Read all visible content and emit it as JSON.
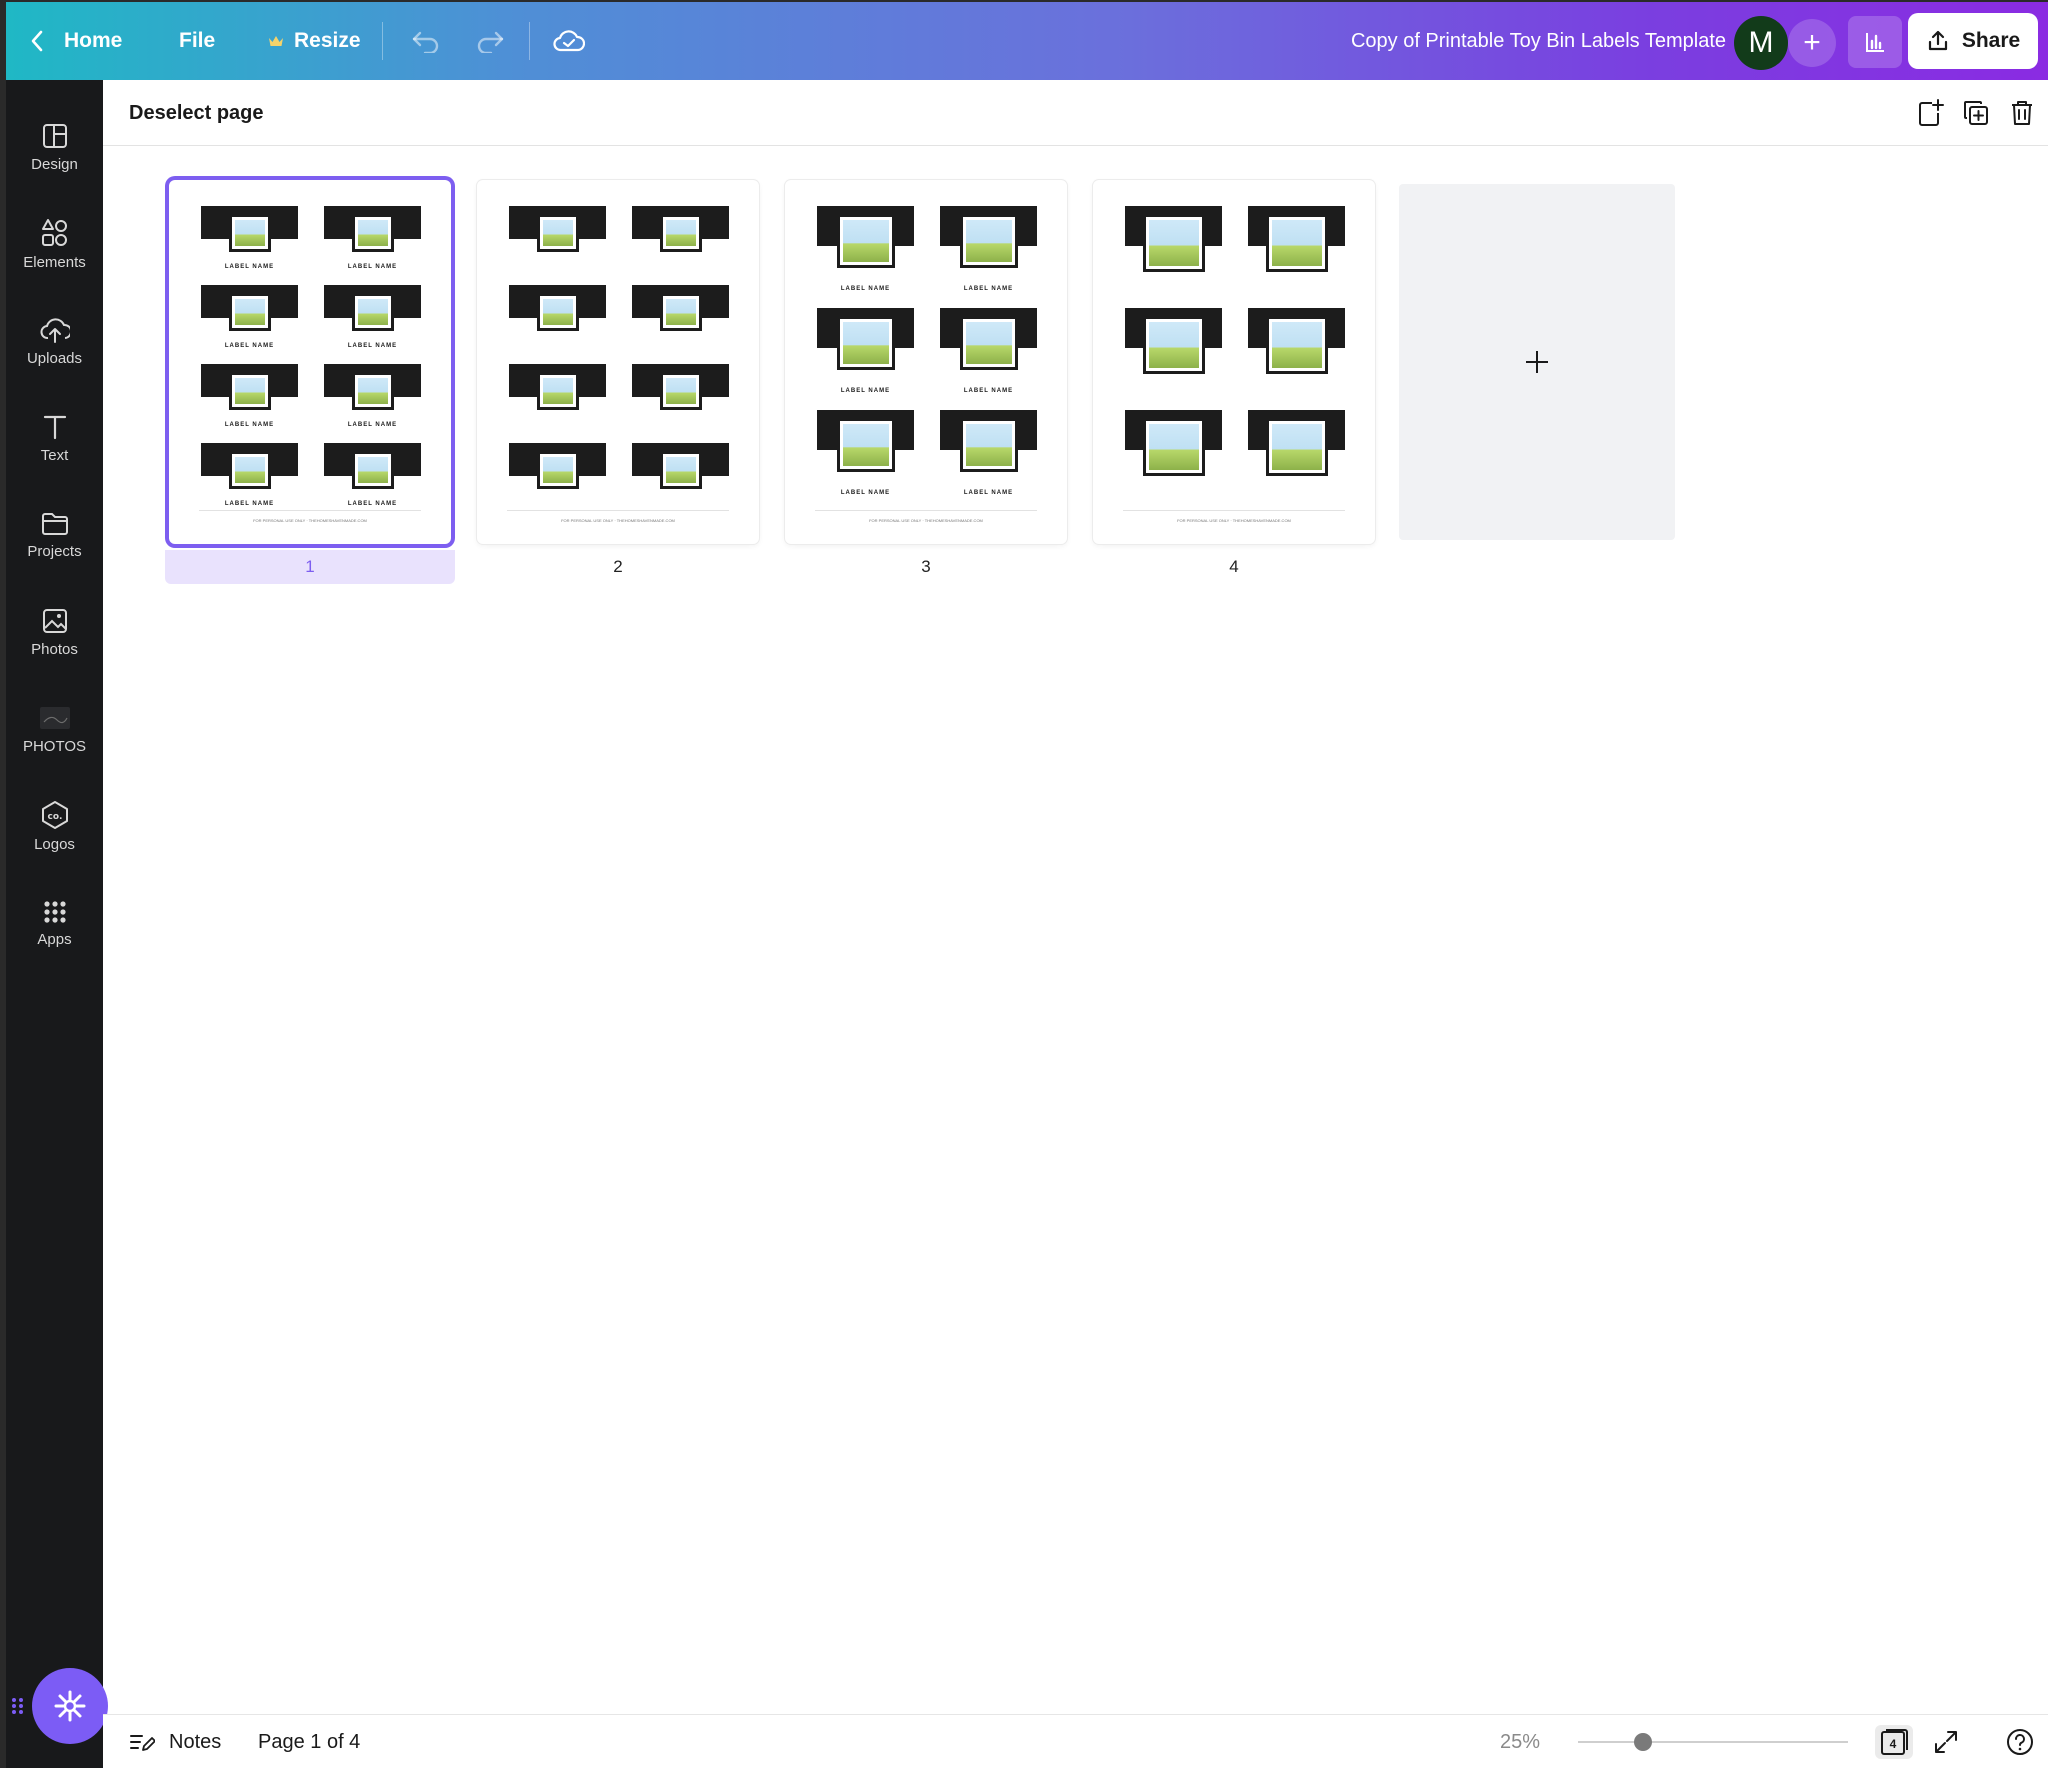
{
  "topbar": {
    "home_label": "Home",
    "file_label": "File",
    "resize_label": "Resize",
    "doc_title": "Copy of Printable Toy Bin Labels Template",
    "avatar_letter": "M",
    "share_label": "Share"
  },
  "sidebar": {
    "items": [
      {
        "label": "Design",
        "icon": "design-icon"
      },
      {
        "label": "Elements",
        "icon": "elements-icon"
      },
      {
        "label": "Uploads",
        "icon": "uploads-icon"
      },
      {
        "label": "Text",
        "icon": "text-icon"
      },
      {
        "label": "Projects",
        "icon": "projects-icon"
      },
      {
        "label": "Photos",
        "icon": "photos-icon"
      },
      {
        "label": "PHOTOS",
        "icon": "photos-app-icon"
      },
      {
        "label": "Logos",
        "icon": "logos-icon"
      },
      {
        "label": "Apps",
        "icon": "apps-icon"
      }
    ]
  },
  "header": {
    "deselect_label": "Deselect page"
  },
  "pages": [
    {
      "number": "1",
      "selected": true
    },
    {
      "number": "2",
      "selected": false
    },
    {
      "number": "3",
      "selected": false
    },
    {
      "number": "4",
      "selected": false
    }
  ],
  "label_text": "LABEL NAME",
  "footer_text": "FOR PERSONAL USE ONLY · THEHOMESHAVENMADE.COM",
  "bottombar": {
    "notes_label": "Notes",
    "page_indicator": "Page 1 of 4",
    "zoom": "25%",
    "zoom_fraction": 0.25,
    "page_count_badge": "4"
  },
  "colors": {
    "accent": "#7d5ef0",
    "sidebar_bg": "#18191b",
    "label_band": "#1c1c1c"
  }
}
